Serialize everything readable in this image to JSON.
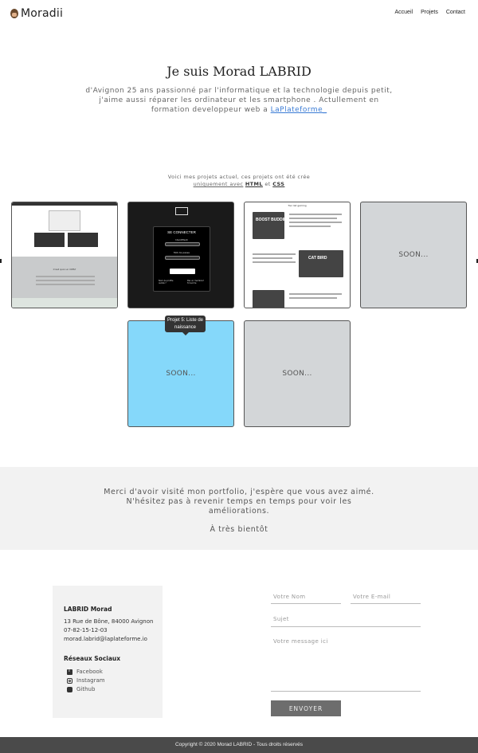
{
  "header": {
    "logo_text": "Moradii",
    "nav": [
      "Accueil",
      "Projets",
      "Contact"
    ]
  },
  "hero": {
    "title": "Je suis Morad LABRID",
    "description": "d'Avignon 25 ans passionné par l'informatique et la technologie depuis petit, j'aime aussi réparer les ordinateur et les smartphone . Actullement en formation developpeur web a",
    "link_text": "LaPlateforme_"
  },
  "projects_intro": {
    "line1": "Voici mes projets actuel, ces projets ont été crée",
    "prefix": "uniquement avec",
    "html": "HTML",
    "and": "et",
    "css": "CSS"
  },
  "projects": {
    "p2_title": "SE CONNECTER",
    "p2_user": "Identifiant",
    "p2_pass": "Mot de passe",
    "p2_btn": "Login",
    "p2_forgot_user": "Nom de profile oublié ?",
    "p2_forgot_pass": "Pas un membre? S'inscrire",
    "p1_caption": "C'est quoi un CMS?",
    "p3_title": "Tier list gaming",
    "p3_img1": "BOOST BUDDIES",
    "p3_img2": "CAT BIRD",
    "soon_label": "SOON...",
    "tooltip": "Projet 5: Liste de naissance"
  },
  "thanks": {
    "message": "Merci d'avoir visité mon portfolio, j'espère que vous avez aimé. N'hésitez pas à revenir temps en temps pour voir les améliorations.",
    "bye": "À très bientôt"
  },
  "contact_card": {
    "name": "LABRID Morad",
    "address": "13 Rue de Bône, 84000 Avignon",
    "phone": "07-82-15-12-03",
    "email": "morad.labrid@laplateforme.io",
    "social_title": "Réseaux Sociaux",
    "social": [
      "Facebook",
      "Instagram",
      "Github"
    ]
  },
  "form": {
    "name_placeholder": "Votre Nom",
    "email_placeholder": "Votre E-mail",
    "subject_placeholder": "Sujet",
    "message_placeholder": "Votre message ici",
    "send_label": "ENVOYER"
  },
  "footer": {
    "copyright": "Copyright © 2020 Morad LABRID - Tous droits réservés"
  }
}
